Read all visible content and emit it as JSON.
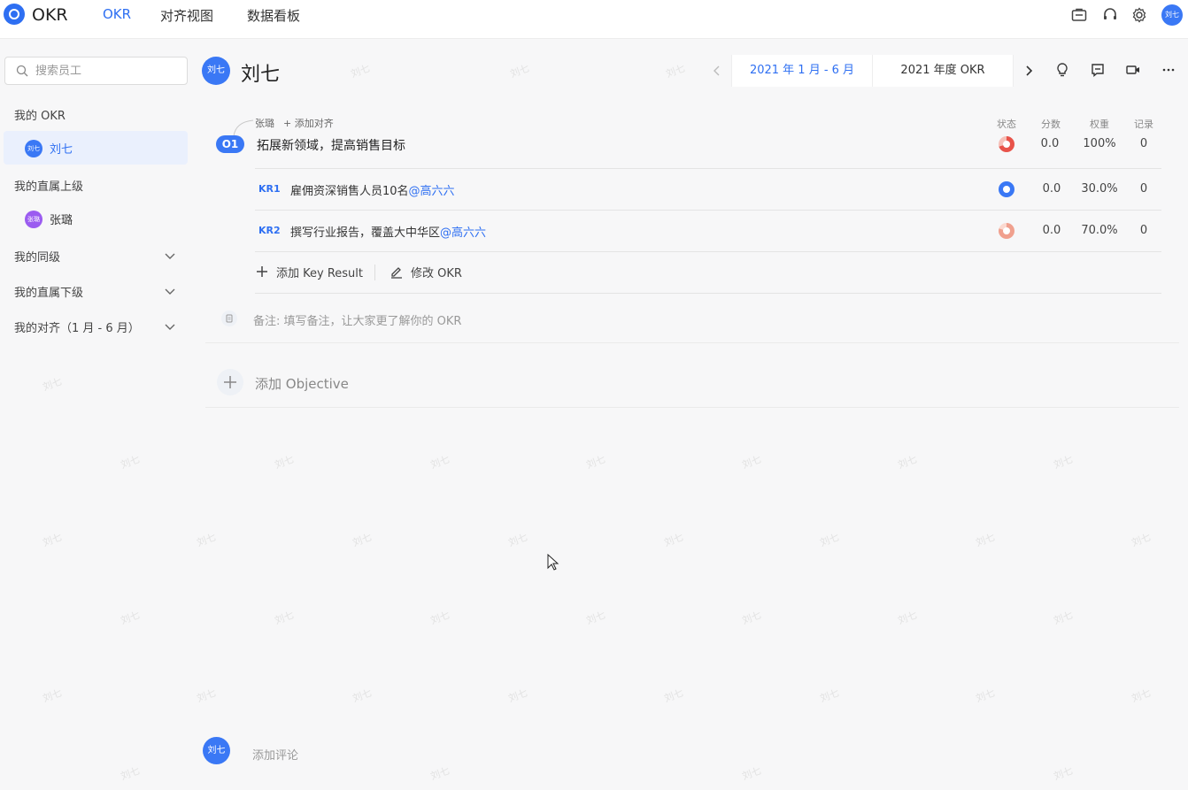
{
  "app": {
    "name": "OKR"
  },
  "nav": {
    "tabs": [
      {
        "label": "OKR",
        "active": true
      },
      {
        "label": "对齐视图"
      },
      {
        "label": "数据看板"
      }
    ]
  },
  "user": {
    "avatar_text": "刘七"
  },
  "sidebar": {
    "search_placeholder": "搜索员工",
    "sections": {
      "my_okr": "我的 OKR",
      "my_superior": "我的直属上级",
      "my_peers": "我的同级",
      "my_subordinates": "我的直属下级",
      "my_alignment": "我的对齐（1 月 - 6 月）"
    },
    "me": {
      "name": "刘七",
      "avatar_text": "刘七"
    },
    "superior": {
      "name": "张璐",
      "avatar_text": "张璐"
    }
  },
  "header": {
    "title": "刘七",
    "avatar_text": "刘七",
    "period": "2021 年 1 月 - 6 月",
    "year_okr": "2021 年度 OKR"
  },
  "columns": {
    "status": "状态",
    "score": "分数",
    "weight": "权重",
    "records": "记录"
  },
  "objective": {
    "badge": "O1",
    "title": "拓展新领域，提高销售目标",
    "aligned_owner": "张璐",
    "add_alignment": "+ 添加对齐",
    "score": "0.0",
    "weight": "100%",
    "records": "0",
    "status_color": "#e8534a",
    "key_results": [
      {
        "badge": "KR1",
        "text": "雇佣资深销售人员10名",
        "mention": "@高六六",
        "score": "0.0",
        "weight": "30.0%",
        "records": "0",
        "status_color": "#3a78f5"
      },
      {
        "badge": "KR2",
        "text": "撰写行业报告，覆盖大中华区",
        "mention": "@高六六",
        "score": "0.0",
        "weight": "70.0%",
        "records": "0",
        "status_color": "#f0a08e"
      }
    ],
    "actions": {
      "add_kr": "添加 Key Result",
      "edit_okr": "修改 OKR"
    },
    "note": "备注:  填写备注，让大家更了解你的 OKR"
  },
  "add_objective": "添加 Objective",
  "comment": {
    "placeholder": "添加评论",
    "avatar_text": "刘七"
  },
  "watermark": "刘七",
  "colors": {
    "accent": "#2e6ff2"
  }
}
